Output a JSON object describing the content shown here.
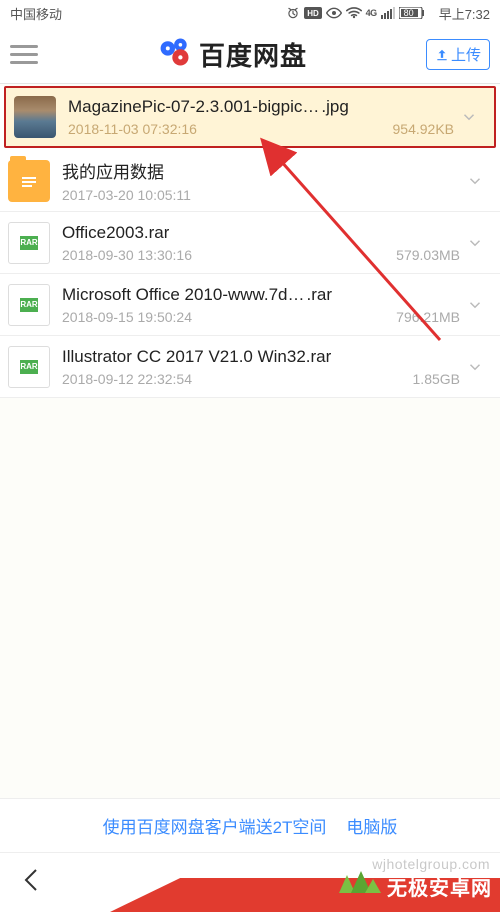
{
  "status": {
    "carrier": "中国移动",
    "battery": "80",
    "time": "早上7:32",
    "sig": "4G"
  },
  "header": {
    "title": "百度网盘",
    "upload": "上传"
  },
  "files": [
    {
      "name_base": "MagazinePic-07-2.3.001-bigpic…",
      "name_ext": ".jpg",
      "date": "2018-11-03 07:32:16",
      "size": "954.92KB",
      "kind": "img",
      "highlight": true
    },
    {
      "name_base": "我的应用数据",
      "name_ext": "",
      "date": "2017-03-20 10:05:11",
      "size": "",
      "kind": "folder",
      "highlight": false
    },
    {
      "name_base": "Office2003.rar",
      "name_ext": "",
      "date": "2018-09-30 13:30:16",
      "size": "579.03MB",
      "kind": "rar",
      "highlight": false
    },
    {
      "name_base": "Microsoft Office 2010-www.7d…",
      "name_ext": ".rar",
      "date": "2018-09-15 19:50:24",
      "size": "796.21MB",
      "kind": "rar",
      "highlight": false
    },
    {
      "name_base": "Illustrator CC 2017 V21.0 Win32.rar",
      "name_ext": "",
      "date": "2018-09-12 22:32:54",
      "size": "1.85GB",
      "kind": "rar",
      "highlight": false
    }
  ],
  "promo": {
    "client": "使用百度网盘客户端送2T空间",
    "pc": "电脑版"
  },
  "watermark": {
    "brand": "无极安卓网",
    "url": "wjhotelgroup.com"
  }
}
